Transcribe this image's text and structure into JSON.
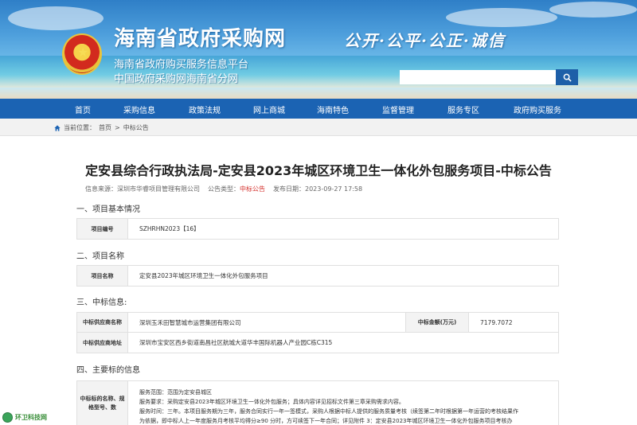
{
  "header": {
    "site_title": "海南省政府采购网",
    "subtitle1": "海南省政府购买服务信息平台",
    "subtitle2": "中国政府采购网海南省分网",
    "motto": "公开·公平·公正·诚信",
    "search_placeholder": ""
  },
  "nav": {
    "items": [
      "首页",
      "采购信息",
      "政策法规",
      "网上商城",
      "海南特色",
      "监督管理",
      "服务专区",
      "政府购买服务"
    ]
  },
  "breadcrumb": {
    "prefix": "当前位置：",
    "home": "首页",
    "sep": ">",
    "current": "中标公告"
  },
  "article": {
    "title": "定安县综合行政执法局-定安县2023年城区环境卫生一体化外包服务项目-中标公告",
    "source_label": "信息来源：",
    "source": "深圳市华睿项目管理有限公司",
    "type_label": "公告类型：",
    "type": "中标公告",
    "date_label": "发布日期：",
    "date": "2023-09-27 17:58"
  },
  "section1": {
    "heading": "一、项目基本情况",
    "label": "项目编号",
    "value": "SZHRHN2023【16】"
  },
  "section2": {
    "heading": "二、项目名称",
    "label": "项目名称",
    "value": "定安县2023年城区环境卫生一体化外包服务项目"
  },
  "section3": {
    "heading": "三、中标信息:",
    "supplier_label": "中标供应商名称",
    "supplier": "深圳玉禾田智慧城市运营集团有限公司",
    "amount_label": "中标金额(万元)",
    "amount": "7179.7072",
    "address_label": "中标供应商地址",
    "address": "深圳市宝安区西乡街道南昌社区航城大道华丰国际机器人产业园C栋C315"
  },
  "section4": {
    "heading": "四、主要标的信息",
    "label": "中标标的名称、规格型号、数",
    "lines": [
      "服务范围：范围为定安县城区",
      "服务要求：采购定安县2023年城区环境卫生一体化外包服务；具体内容详见招标文件第三章采购需求内容。",
      "服务时间：三年。本项目服务期为三年，服务合同实行一年一签模式，采购人根据中标人提供的服务质量考核（续签第二年时根据第一年运营的考核结果作",
      "为依据，即中标人上一年度服务月考核平均得分≥90 分时，方可续签下一年合同；详见附件 3：定安县2023年城区环境卫生一体化外包服务项目考核办"
    ]
  },
  "watermark": "环卫科技网"
}
